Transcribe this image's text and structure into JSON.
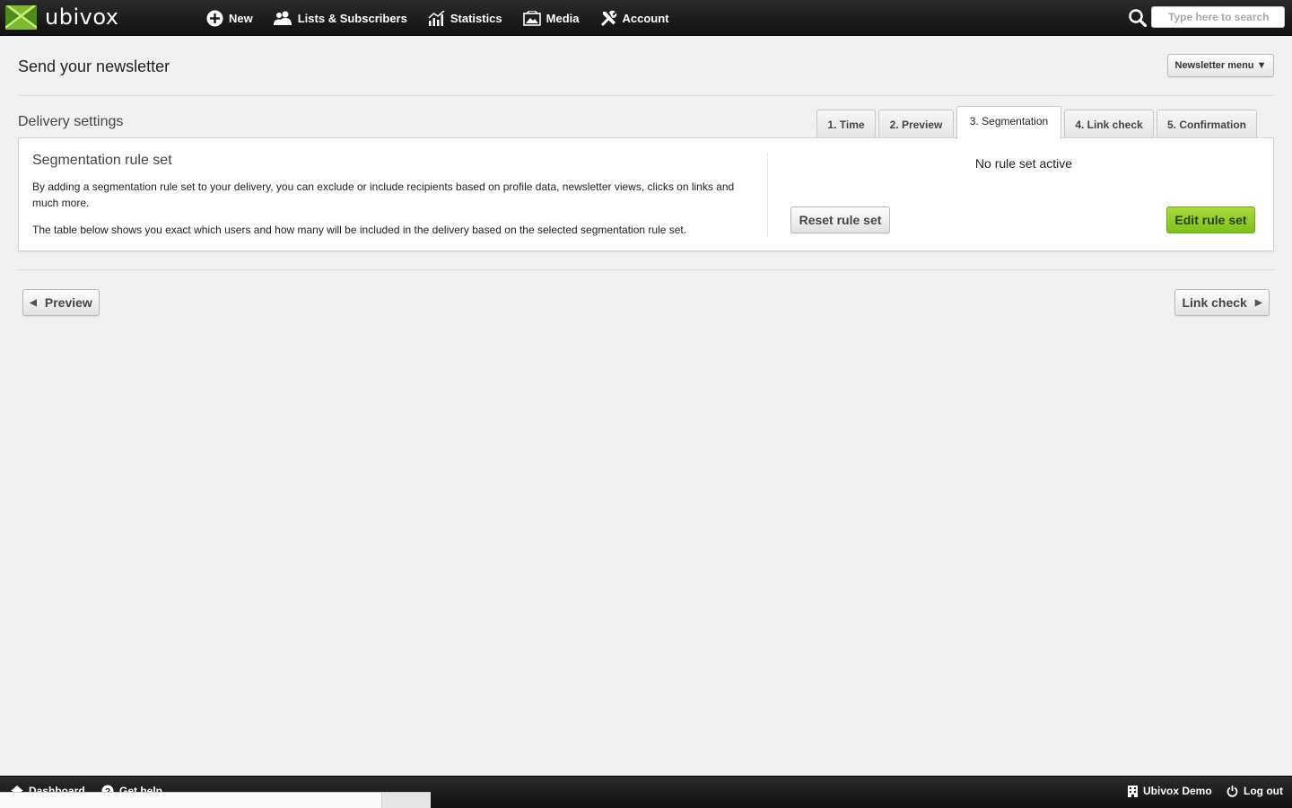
{
  "app": {
    "name": "ubivox"
  },
  "nav": {
    "items": [
      {
        "label": "New",
        "icon": "plus-circle-icon"
      },
      {
        "label": "Lists & Subscribers",
        "icon": "users-icon"
      },
      {
        "label": "Statistics",
        "icon": "bar-chart-icon"
      },
      {
        "label": "Media",
        "icon": "image-icon"
      },
      {
        "label": "Account",
        "icon": "tools-icon"
      }
    ]
  },
  "search": {
    "placeholder": "Type here to search"
  },
  "page": {
    "title": "Send your newsletter",
    "newsletter_menu": "Newsletter menu ▼",
    "section_title": "Delivery settings"
  },
  "tabs": [
    {
      "label": "1. Time",
      "active": false
    },
    {
      "label": "2. Preview",
      "active": false
    },
    {
      "label": "3. Segmentation",
      "active": true
    },
    {
      "label": "4. Link check",
      "active": false
    },
    {
      "label": "5. Confirmation",
      "active": false
    }
  ],
  "panel": {
    "title": "Segmentation rule set",
    "desc1": "By adding a segmentation rule set to your delivery, you can exclude or include recipients based on profile data, newsletter views, clicks on links and much more.",
    "desc2": "The table below shows you exact which users and how many will be included in the delivery based on the selected segmentation rule set.",
    "status": "No rule set active",
    "reset_label": "Reset rule set",
    "edit_label": "Edit rule set"
  },
  "pager": {
    "prev_label": "Preview",
    "next_label": "Link check"
  },
  "footer": {
    "dashboard": "Dashboard",
    "help": "Get help",
    "account_name": "Ubivox Demo",
    "logout": "Log out"
  },
  "colors": {
    "topbar": "#1a1a1a",
    "accent_green": "#8fcc24",
    "page_bg": "#f1f1f1"
  }
}
